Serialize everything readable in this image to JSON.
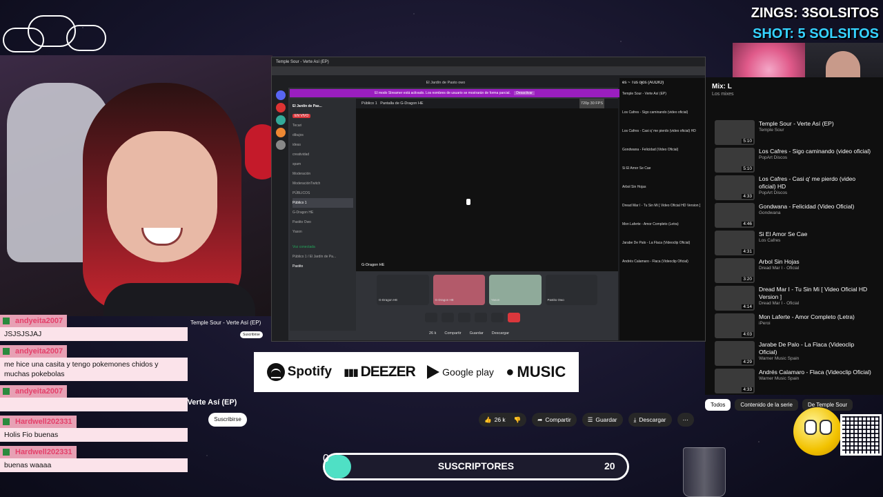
{
  "overlay": {
    "zings_line": "ZINGS: 3SOLSITOS",
    "shot_line": "SHOT: 5 SOLSITOS"
  },
  "captured_window": {
    "browser_tab": "Temple Sour - Verte Así (EP)",
    "discord_title": "El Jardín de Pasto owo",
    "notice": "El modo Streamer está activado. Los nombres de usuario se mostrarán de forma parcial.",
    "notice_button": "Desactivar",
    "server_name": "El Jardín de Pas...",
    "channel_public": "Público 1",
    "stream_label": "Pantalla de G-Dragon HE",
    "stream_quality": "720p 30 FPS",
    "live_badge": "EN VIVO",
    "stream_owner": "G-Dragon HE",
    "channels": [
      "Tecari",
      "dibujos",
      "ideas",
      "creatividad",
      "spam",
      "Moderación",
      "ModeraciónTwitch",
      "PÚBLICOS",
      "Público 1",
      "G-Dragon HE",
      "Pastito Owo",
      "Yason"
    ],
    "voice_status": "Voz conectada",
    "voice_channel": "Público 1 / El Jardín de Pa...",
    "user_name": "Pastito",
    "tiles": [
      "G-Dragon HE",
      "G-Dragon HE",
      "Yason",
      "Pastito Owo"
    ],
    "side_panel_title": "es ~ Tus ojos (AUDIO)",
    "side_panel_items": [
      "Temple Sour - Verte Así (EP)",
      "Los Cafres - Sigo caminando (video oficial)",
      "Los Cafres - Casi q' me pierdo (video oficial) HD",
      "Gondwana - Felicidad (Video Oficial)",
      "Si El Amor Se Cae",
      "Arbol Sin Hojas",
      "Dread Mar I - Tu Sin Mi [ Video Oficial HD Version ]",
      "Mon Laferte - Amor Completo (Letra)",
      "Jarabe De Palo - La Flaca (Videoclip Oficial)",
      "Andrés Calamaro - Flaca (Videoclip Oficial)"
    ],
    "inner_video_title": "Temple Sour - Verte Así (EP)",
    "inner_subscribe": "Suscribirse",
    "inner_likes": "26 k",
    "inner_share": "Compartir",
    "inner_save": "Guardar",
    "inner_download": "Descargar"
  },
  "music_services": {
    "spotify": "Spotify",
    "deezer": "DEEZER",
    "google_play": "Google play",
    "apple_music": "MUSIC"
  },
  "youtube": {
    "video_title": "Temple Sour - Verte Así (EP)",
    "subscribe": "Suscribirse",
    "likes": "26 k",
    "share": "Compartir",
    "save": "Guardar",
    "download": "Descargar",
    "mix_header": "Mix: L",
    "mix_sub": "Los mixes",
    "playlist": [
      {
        "title": "Temple Sour - Verte Así (EP)",
        "artist": "Temple Sour",
        "duration": "5:10"
      },
      {
        "title": "Los Cafres - Sigo caminando (video oficial)",
        "artist": "PopArt Discos",
        "duration": "5:10"
      },
      {
        "title": "Los Cafres - Casi q' me pierdo (video oficial) HD",
        "artist": "PopArt Discos",
        "duration": "4:33"
      },
      {
        "title": "Gondwana - Felicidad (Video Oficial)",
        "artist": "Gondwana",
        "duration": "4:46"
      },
      {
        "title": "Si El Amor Se Cae",
        "artist": "Los Cafres",
        "duration": "4:31"
      },
      {
        "title": "Arbol Sin Hojas",
        "artist": "Dread Mar I - Oficial",
        "duration": "3:20"
      },
      {
        "title": "Dread Mar I - Tu Sin Mi [ Video Oficial HD Version ]",
        "artist": "Dread Mar I - Oficial",
        "duration": "4:14"
      },
      {
        "title": "Mon Laferte - Amor Completo (Letra)",
        "artist": "iPeroi",
        "duration": "4:03"
      },
      {
        "title": "Jarabe De Palo - La Flaca (Videoclip Oficial)",
        "artist": "Warner Music Spain",
        "duration": "4:29"
      },
      {
        "title": "Andrés Calamaro - Flaca (Videoclip Oficial)",
        "artist": "Warner Music Spain",
        "duration": "4:33"
      }
    ],
    "chips": [
      "Todos",
      "Contenido de la serie",
      "De Temple Sour"
    ]
  },
  "chat": [
    {
      "user": "andyeita2007",
      "message": "JSJSJSJAJ"
    },
    {
      "user": "andyeita2007",
      "message": "me hice una casita y tengo pokemones chidos y muchas pokebolas"
    },
    {
      "user": "andyeita2007",
      "message": ""
    },
    {
      "user": "Hardwell202331",
      "message": "Holis Fio buenas"
    },
    {
      "user": "Hardwell202331",
      "message": "buenas waaaa"
    }
  ],
  "subs_goal": {
    "current": "0",
    "label": "SUSCRIPTORES",
    "goal": "20",
    "progress_fraction": 0
  },
  "colors": {
    "chat_name_bg": "#e7a0b4",
    "chat_msg_bg": "#fbe3ea",
    "goal_fill": "#4fe0c5",
    "discord_notice": "#9a1ebf",
    "shot_color": "#35d3ff"
  }
}
